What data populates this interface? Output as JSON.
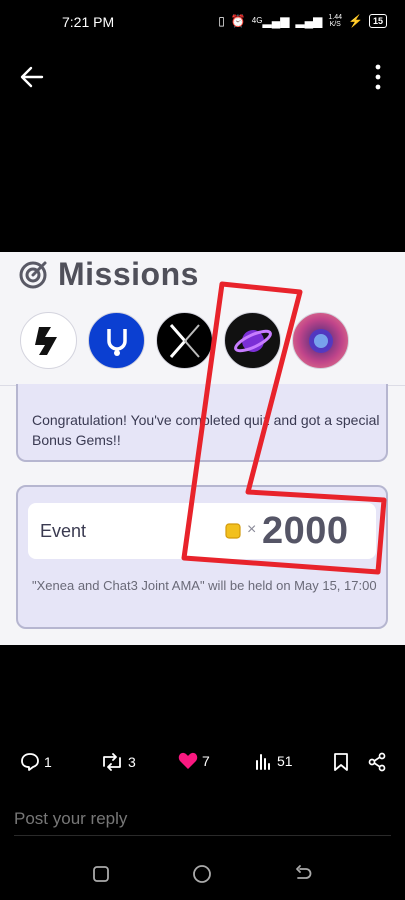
{
  "status_bar": {
    "time": "7:21 PM",
    "network_speed_value": "1.44",
    "network_speed_unit": "K/S",
    "signal_label": "4G",
    "battery": "15"
  },
  "post_image": {
    "missions_title": "Missions",
    "congrats_text": "Congratulation! You've completed quiz and got a special Bonus Gems!!",
    "event_label": "Event",
    "multiplier": "×",
    "amount": "2000",
    "event_note": "\"Xenea and Chat3 Joint AMA\" will be held on May 15, 17:00"
  },
  "actions": {
    "replies": "1",
    "reposts": "3",
    "likes": "7",
    "views": "51"
  },
  "reply": {
    "placeholder": "Post your reply"
  },
  "colors": {
    "accent_like": "#f91880",
    "annotation_red": "#e8232b",
    "card_bg": "#e6e5f7"
  }
}
